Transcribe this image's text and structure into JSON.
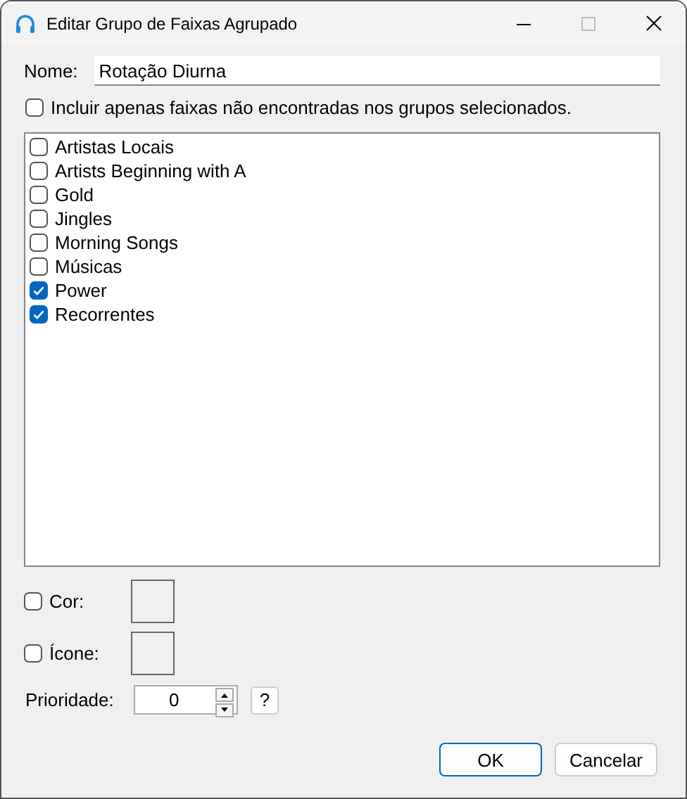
{
  "window": {
    "title": "Editar Grupo de Faixas Agrupado"
  },
  "name_field": {
    "label": "Nome:",
    "value": "Rotação Diurna"
  },
  "exclude_option": {
    "label": "Incluir apenas faixas não encontradas nos grupos selecionados.",
    "checked": false
  },
  "groups": [
    {
      "label": "Artistas Locais",
      "checked": false
    },
    {
      "label": "Artists Beginning with A",
      "checked": false
    },
    {
      "label": "Gold",
      "checked": false
    },
    {
      "label": "Jingles",
      "checked": false
    },
    {
      "label": "Morning Songs",
      "checked": false
    },
    {
      "label": "Músicas",
      "checked": false
    },
    {
      "label": "Power",
      "checked": true
    },
    {
      "label": "Recorrentes",
      "checked": true
    }
  ],
  "color_option": {
    "label": "Cor:",
    "checked": false
  },
  "icon_option": {
    "label": "Ícone:",
    "checked": false
  },
  "priority": {
    "label": "Prioridade:",
    "value": "0"
  },
  "help_button": "?",
  "buttons": [
    {
      "label": "OK",
      "default": true
    },
    {
      "label": "Cancelar",
      "default": false
    }
  ]
}
